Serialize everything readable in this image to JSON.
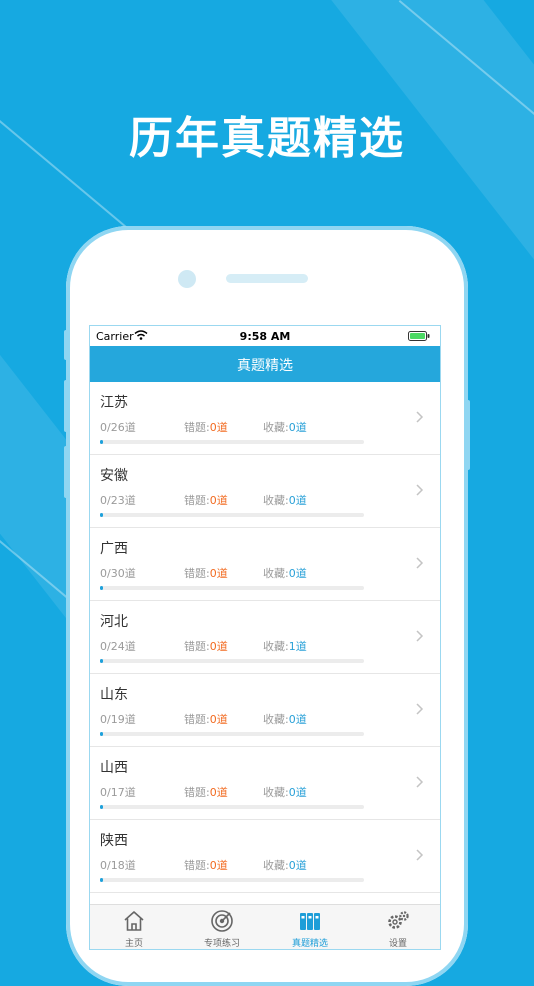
{
  "promo": {
    "title": "历年真题精选"
  },
  "status_bar": {
    "carrier": "Carrier",
    "time": "9:58 AM"
  },
  "nav": {
    "title": "真题精选"
  },
  "labels": {
    "wrong": "错题:",
    "fav": "收藏:"
  },
  "list": [
    {
      "name": "江苏",
      "progress": "0/26道",
      "wrong": "0道",
      "fav": "0道",
      "done_fraction": 0
    },
    {
      "name": "安徽",
      "progress": "0/23道",
      "wrong": "0道",
      "fav": "0道",
      "done_fraction": 0
    },
    {
      "name": "广西",
      "progress": "0/30道",
      "wrong": "0道",
      "fav": "0道",
      "done_fraction": 0
    },
    {
      "name": "河北",
      "progress": "0/24道",
      "wrong": "0道",
      "fav": "1道",
      "done_fraction": 0
    },
    {
      "name": "山东",
      "progress": "0/19道",
      "wrong": "0道",
      "fav": "0道",
      "done_fraction": 0
    },
    {
      "name": "山西",
      "progress": "0/17道",
      "wrong": "0道",
      "fav": "0道",
      "done_fraction": 0
    },
    {
      "name": "陕西",
      "progress": "0/18道",
      "wrong": "0道",
      "fav": "0道",
      "done_fraction": 0
    }
  ],
  "tabs": [
    {
      "label": "主页",
      "icon": "home-icon"
    },
    {
      "label": "专项练习",
      "icon": "target-icon"
    },
    {
      "label": "真题精选",
      "icon": "binders-icon",
      "active": true
    },
    {
      "label": "设置",
      "icon": "gear-icon"
    }
  ],
  "colors": {
    "accent": "#25a7dc",
    "background": "#16a9e1",
    "wrong": "#f26b21",
    "fav": "#2aa1d8"
  }
}
